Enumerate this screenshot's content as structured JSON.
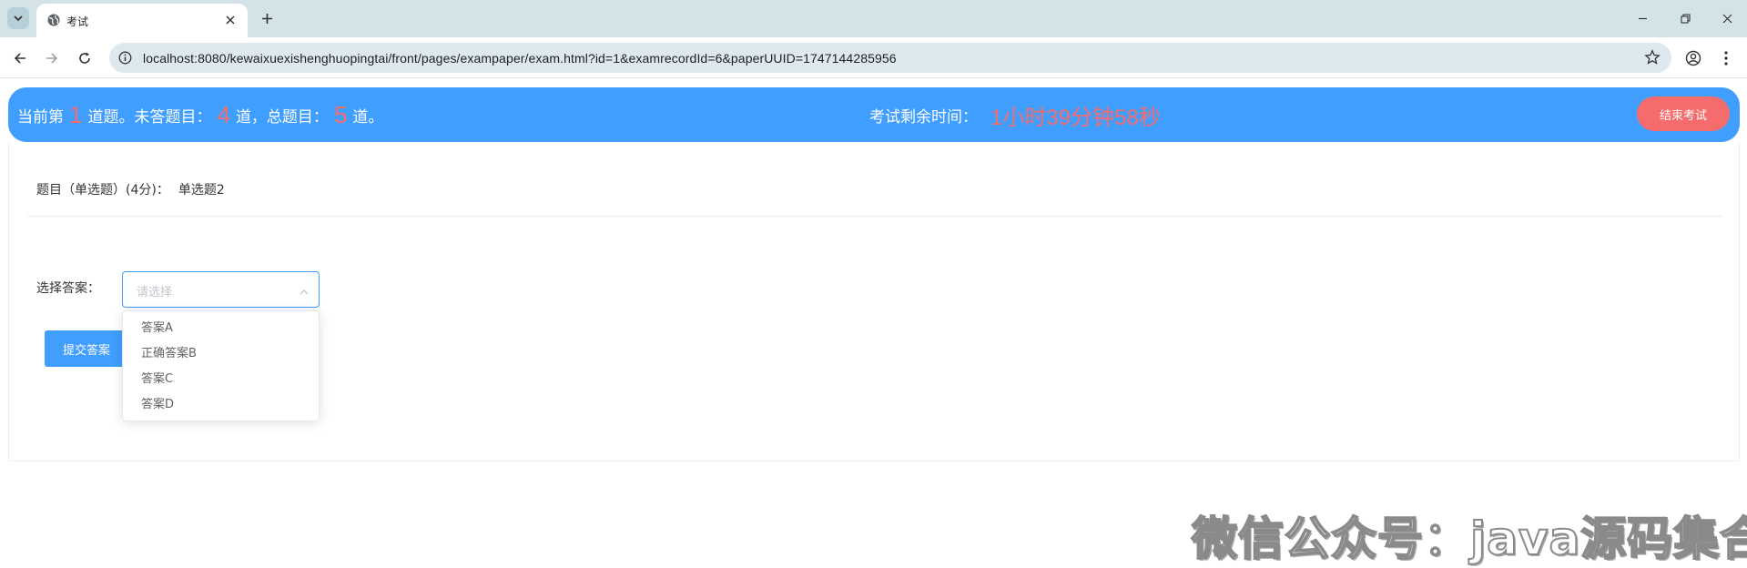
{
  "browser": {
    "tab_title": "考试",
    "url": "localhost:8080/kewaixuexishenghuopingtai/front/pages/exampaper/exam.html?id=1&examrecordId=6&paperUUID=1747144285956",
    "icons": [
      "tab-search-icon",
      "globe-icon",
      "close-icon",
      "plus-icon",
      "minimize-icon",
      "restore-icon",
      "close-window-icon",
      "back-arrow-icon",
      "forward-arrow-icon",
      "reload-icon",
      "info-icon",
      "star-icon",
      "profile-icon",
      "more-menu-icon"
    ]
  },
  "banner": {
    "prefix": "当前第",
    "current": "1",
    "after_current": "道题。未答题目：",
    "unanswered": "4",
    "after_unanswered": "道，总题目：",
    "total": "5",
    "suffix": "道。",
    "time_label": "考试剩余时间：",
    "time_value": "1小时39分钟58秒",
    "end_button": "结束考试"
  },
  "question": {
    "title": "题目（单选题）(4分)：",
    "content": "单选题2",
    "answer_label": "选择答案：",
    "select_placeholder": "请选择",
    "options": [
      "答案A",
      "正确答案B",
      "答案C",
      "答案D"
    ],
    "submit_button": "提交答案"
  },
  "watermark": "微信公众号：java源码集合",
  "colors": {
    "primary": "#409eff",
    "danger": "#f56c6c",
    "tabbar": "#d3e3e8"
  }
}
